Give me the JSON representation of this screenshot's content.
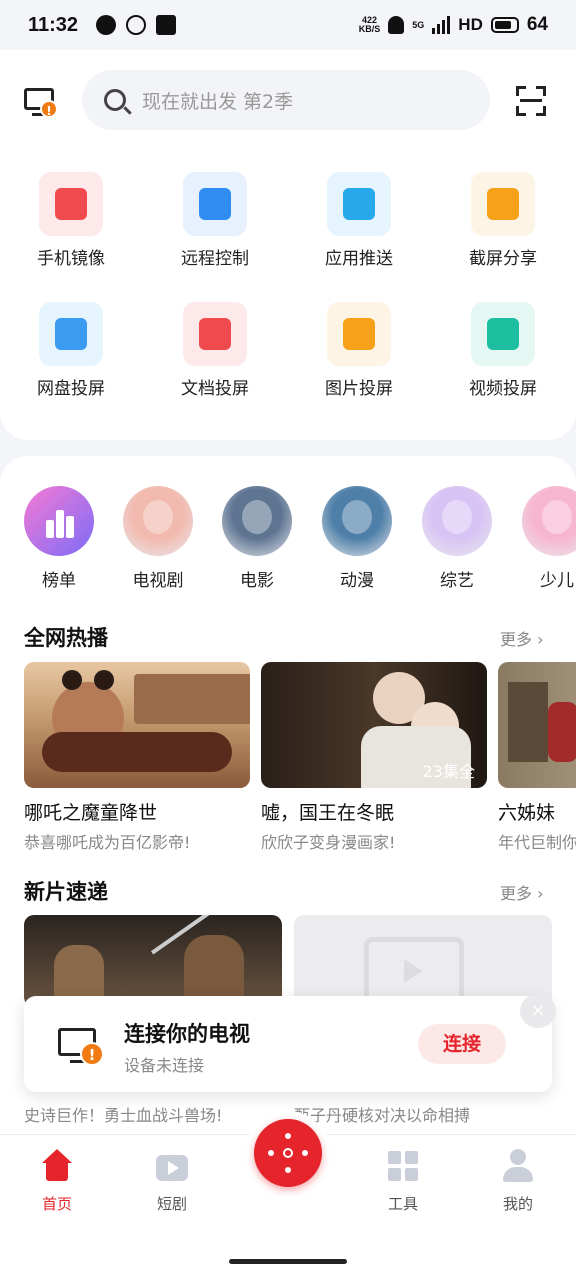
{
  "status": {
    "time": "11:32",
    "net_speed": "422\nKB/S",
    "net_label_top": "422",
    "net_label_bottom": "KB/S",
    "hd": "HD",
    "battery": "64",
    "signal": "5G"
  },
  "search": {
    "placeholder": "现在就出发 第2季"
  },
  "tools": [
    {
      "label": "手机镜像",
      "icon": "phone-mirror-icon",
      "bg": "#fde9ea",
      "fg": "#ef4b4f"
    },
    {
      "label": "远程控制",
      "icon": "remote-control-icon",
      "bg": "#e7f1fd",
      "fg": "#2f8cf0"
    },
    {
      "label": "应用推送",
      "icon": "app-push-icon",
      "bg": "#e6f4fd",
      "fg": "#26a8ea"
    },
    {
      "label": "截屏分享",
      "icon": "screenshot-share-icon",
      "bg": "#fdf4e5",
      "fg": "#f7a11a"
    },
    {
      "label": "网盘投屏",
      "icon": "cloud-cast-icon",
      "bg": "#e6f4fd",
      "fg": "#3a9bf0"
    },
    {
      "label": "文档投屏",
      "icon": "document-cast-icon",
      "bg": "#fde9ea",
      "fg": "#ef4b4f"
    },
    {
      "label": "图片投屏",
      "icon": "image-cast-icon",
      "bg": "#fdf4e5",
      "fg": "#f7a11a"
    },
    {
      "label": "视频投屏",
      "icon": "video-cast-icon",
      "bg": "#e4f7f3",
      "fg": "#1dbfa0"
    }
  ],
  "categories": [
    {
      "label": "榜单",
      "color": "#b36cf5"
    },
    {
      "label": "电视剧",
      "color": "#f2b9ae"
    },
    {
      "label": "电影",
      "color": "#5e7592"
    },
    {
      "label": "动漫",
      "color": "#4e7fa8"
    },
    {
      "label": "综艺",
      "color": "#d8c4f4"
    },
    {
      "label": "少儿",
      "color": "#f7b6cf"
    }
  ],
  "hot": {
    "title": "全网热播",
    "more": "更多",
    "items": [
      {
        "title": "哪吒之魔童降世",
        "sub": "恭喜哪吒成为百亿影帝!",
        "badge": ""
      },
      {
        "title": "嘘，国王在冬眠",
        "sub": "欣欣子变身漫画家!",
        "badge": "23集全"
      },
      {
        "title": "六姊妹",
        "sub": "年代巨制你",
        "badge": ""
      }
    ]
  },
  "new": {
    "title": "新片速递",
    "more": "更多",
    "items": [
      {
        "sub": "史诗巨作！勇士血战斗兽场!"
      },
      {
        "sub": "甄子丹硬核对决以命相搏"
      }
    ]
  },
  "toast": {
    "title": "连接你的电视",
    "sub": "设备未连接",
    "button": "连接",
    "close": "×"
  },
  "tabbar": [
    {
      "label": "首页",
      "icon": "home-icon",
      "active": true
    },
    {
      "label": "短剧",
      "icon": "short-drama-icon",
      "active": false
    },
    {
      "label": "工具",
      "icon": "tools-grid-icon",
      "active": false
    },
    {
      "label": "我的",
      "icon": "profile-icon",
      "active": false
    }
  ],
  "colors": {
    "accent": "#e5242b",
    "warning": "#f07b12"
  }
}
